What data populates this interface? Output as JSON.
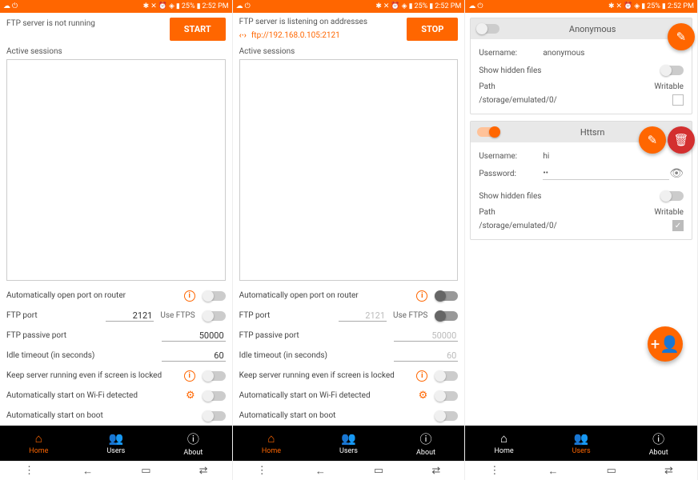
{
  "statusbar": {
    "battery": "25%",
    "time": "2:52 PM"
  },
  "s1": {
    "status": "FTP server is not running",
    "btn": "START",
    "sessions_label": "Active sessions",
    "settings": {
      "auto_port": "Automatically open port on router",
      "ftp_port_label": "FTP port",
      "ftp_port_val": "2121",
      "use_ftps": "Use FTPS",
      "passive_label": "FTP passive port",
      "passive_val": "50000",
      "idle_label": "Idle timeout (in seconds)",
      "idle_val": "60",
      "keep_running": "Keep server running even if screen is locked",
      "auto_wifi": "Automatically start on Wi-Fi detected",
      "auto_boot": "Automatically start on boot"
    }
  },
  "s2": {
    "status": "FTP server is listening on addresses",
    "address": "ftp://192.168.0.105:2121",
    "btn": "STOP"
  },
  "nav": {
    "home": "Home",
    "users": "Users",
    "about": "About"
  },
  "users": {
    "card1": {
      "title": "Anonymous",
      "username_label": "Username:",
      "username_val": "anonymous",
      "hidden_label": "Show hidden files",
      "path_label": "Path",
      "writable_label": "Writable",
      "path_val": "/storage/emulated/0/"
    },
    "card2": {
      "title": "Httsrn",
      "username_label": "Username:",
      "username_val": "hi",
      "password_label": "Password:",
      "password_val": "••",
      "hidden_label": "Show hidden files",
      "path_label": "Path",
      "writable_label": "Writable",
      "path_val": "/storage/emulated/0/"
    }
  }
}
